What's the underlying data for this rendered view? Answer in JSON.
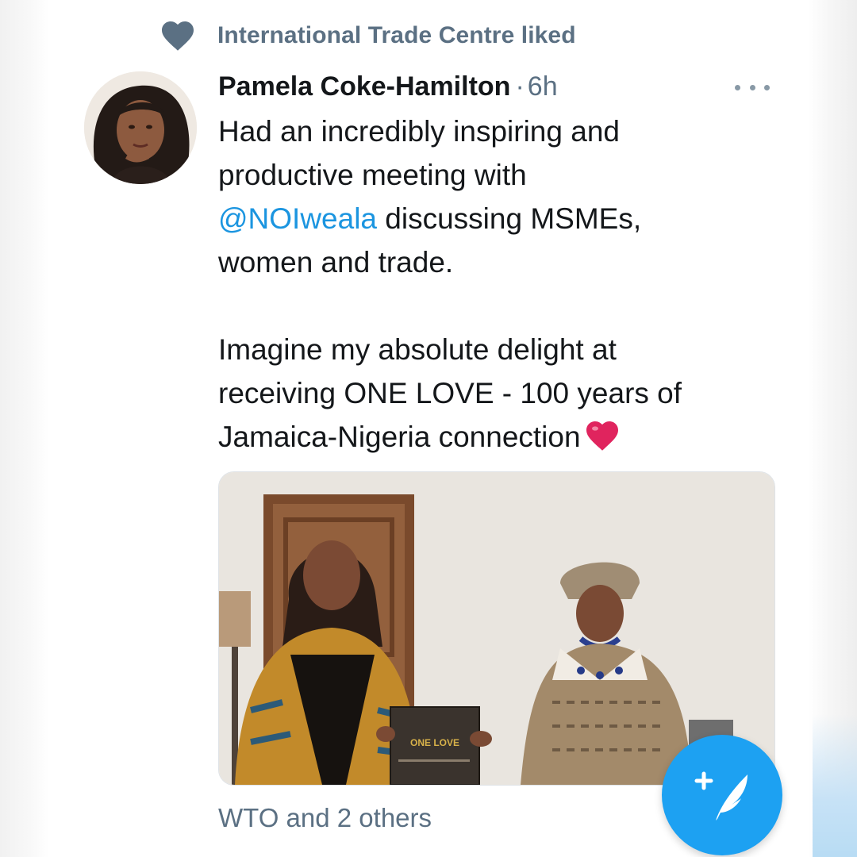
{
  "social_context": {
    "text": "International Trade Centre liked",
    "icon": "heart-icon"
  },
  "tweet": {
    "author_name": "Pamela Coke-Hamilton",
    "separator": "·",
    "timestamp": "6h",
    "more_icon": "more-horizontal-icon",
    "paragraph1": {
      "line1": "Had an incredibly inspiring and",
      "line2": "productive meeting with",
      "mention": "@NOIweala",
      "line3_rest": " discussing MSMEs,",
      "line4": "women and trade."
    },
    "paragraph2": {
      "line1": "Imagine my absolute delight at",
      "line2": "receiving ONE LOVE - 100 years of",
      "line3": "Jamaica-Nigeria connection",
      "emoji": "red-heart-emoji"
    },
    "media": {
      "book_title": "ONE LOVE"
    }
  },
  "likes_context": "WTO and 2 others",
  "compose_button": {
    "icon": "compose-tweet-icon"
  },
  "colors": {
    "text_primary": "#14171a",
    "text_secondary": "#5b7083",
    "link": "#1b95e0",
    "brand_blue": "#1da1f2",
    "heart_red": "#e0245e"
  }
}
